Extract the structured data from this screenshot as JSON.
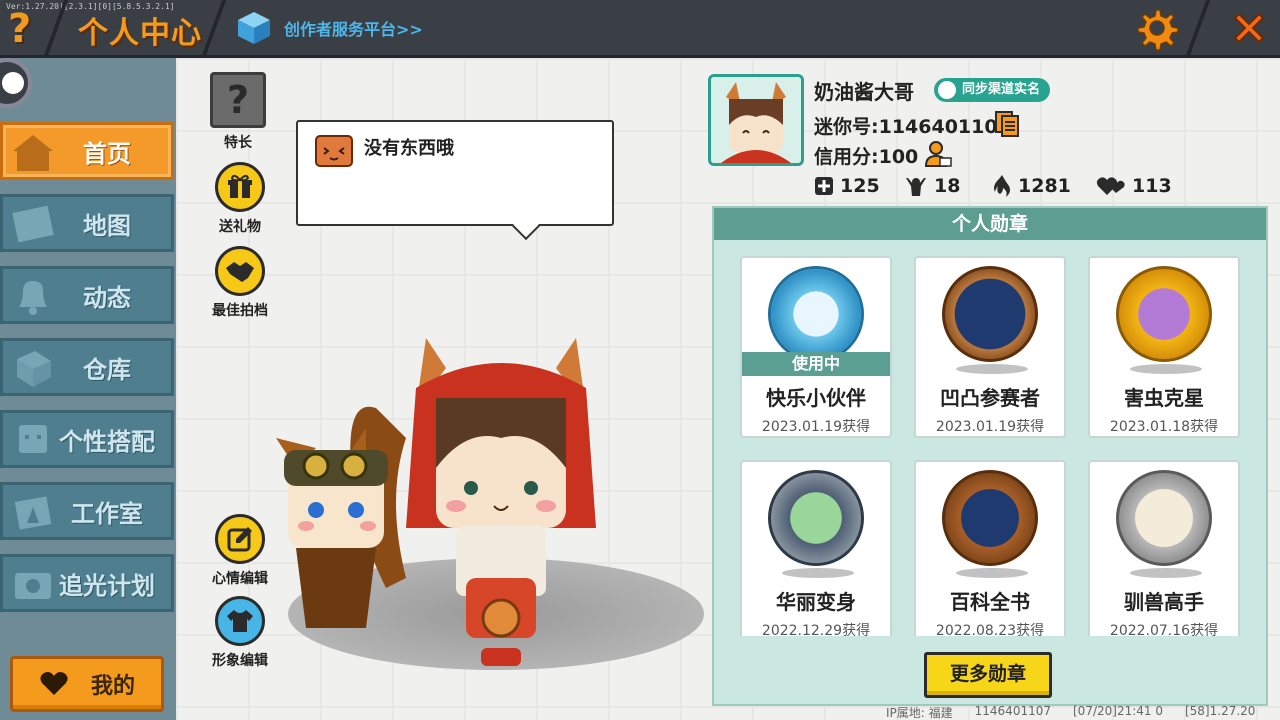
{
  "topbar": {
    "version_text": "Ver:1.27.20|[2.3.1][0][5.8.5.3.2.1]",
    "title": "个人中心",
    "creator_link": "创作者服务平台>>"
  },
  "sidebar": {
    "items": [
      {
        "label": "首页",
        "icon": "house-icon"
      },
      {
        "label": "地图",
        "icon": "map-icon"
      },
      {
        "label": "动态",
        "icon": "bell-icon"
      },
      {
        "label": "仓库",
        "icon": "box-icon"
      },
      {
        "label": "个性搭配",
        "icon": "character-icon"
      },
      {
        "label": "工作室",
        "icon": "studio-icon"
      },
      {
        "label": "追光计划",
        "icon": "camera-icon"
      }
    ],
    "mine_label": "我的"
  },
  "side_buttons": {
    "specialty": "特长",
    "specialty_glyph": "?",
    "gift": "送礼物",
    "best_photo": "最佳拍档",
    "mood_edit": "心情编辑",
    "image_edit": "形象编辑"
  },
  "bubble": {
    "text": "没有东西哦"
  },
  "profile": {
    "name": "奶油酱大哥",
    "verify_label": "同步渠道实名",
    "mini_id": "迷你号:1146401107",
    "credit": "信用分:100",
    "stats": {
      "likes": "125",
      "fans": "18",
      "heat": "1281",
      "hearts": "113"
    }
  },
  "medals": {
    "title": "个人勋章",
    "in_use_label": "使用中",
    "items": [
      {
        "name": "快乐小伙伴",
        "date": "2023.01.19获得",
        "color": "#6cc7ea"
      },
      {
        "name": "凹凸参赛者",
        "date": "2023.01.19获得",
        "color": "#b9773d"
      },
      {
        "name": "害虫克星",
        "date": "2023.01.18获得",
        "color": "#f2b514"
      },
      {
        "name": "华丽变身",
        "date": "2022.12.29获得",
        "color": "#8f9aa3"
      },
      {
        "name": "百科全书",
        "date": "2022.08.23获得",
        "color": "#b9773d"
      },
      {
        "name": "驯兽高手",
        "date": "2022.07.16获得",
        "color": "#b8b8b8"
      }
    ],
    "more_label": "更多勋章"
  },
  "footer": {
    "ip": "IP属地: 福建",
    "uid": "1146401107",
    "time": "[07/20]21:41 0",
    "ver": "[58]1.27.20"
  },
  "colors": {
    "accent_orange": "#f49a1c",
    "teal": "#5d9e91",
    "nav_blue": "#4f7e8e"
  }
}
